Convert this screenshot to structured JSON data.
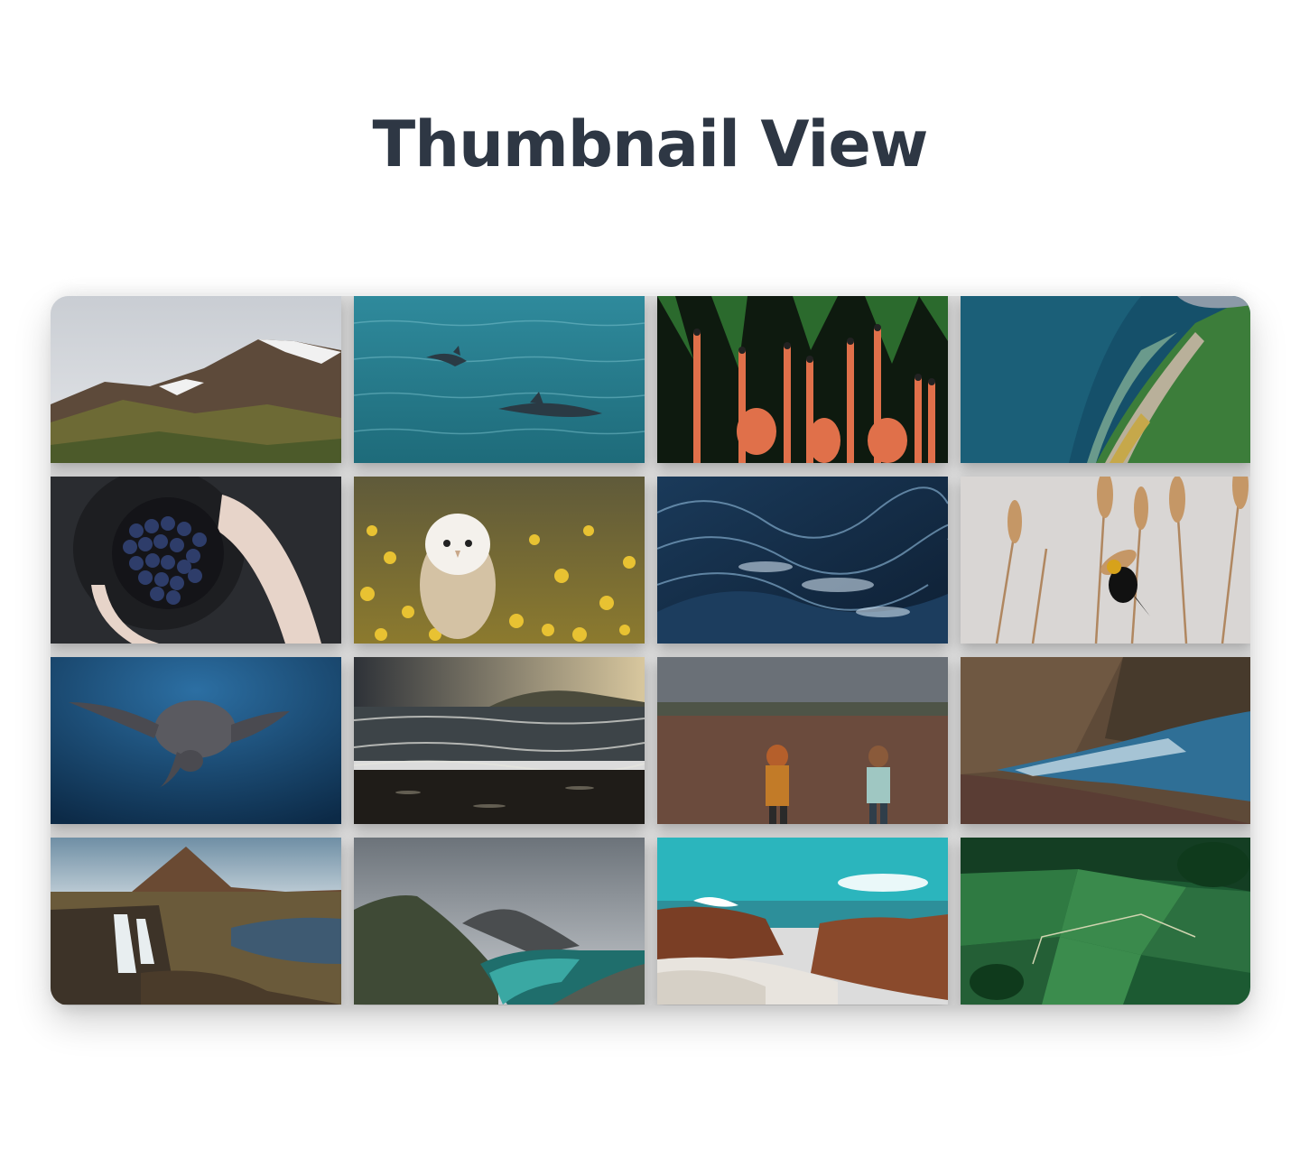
{
  "page": {
    "title": "Thumbnail View"
  },
  "thumbnails": [
    {
      "subject": "snowy-mountains"
    },
    {
      "subject": "dolphins-ocean"
    },
    {
      "subject": "flamingos"
    },
    {
      "subject": "aerial-coastline"
    },
    {
      "subject": "grapes-bowl"
    },
    {
      "subject": "owl-flowers"
    },
    {
      "subject": "ocean-waves"
    },
    {
      "subject": "bird-reeds"
    },
    {
      "subject": "sea-turtle"
    },
    {
      "subject": "beach-sunset"
    },
    {
      "subject": "children-field"
    },
    {
      "subject": "cliff-sea"
    },
    {
      "subject": "waterfall-mountain"
    },
    {
      "subject": "fjord-beach"
    },
    {
      "subject": "rocky-shore"
    },
    {
      "subject": "green-fields"
    }
  ]
}
